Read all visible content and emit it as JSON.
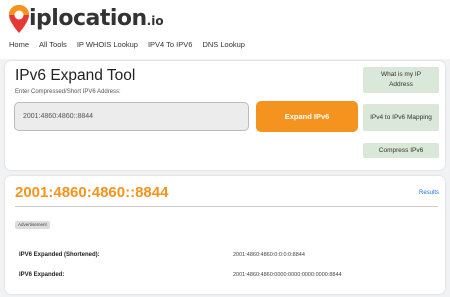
{
  "logo": {
    "brand": "iplocation",
    "tld": ".io"
  },
  "nav": {
    "items": [
      "Home",
      "All Tools",
      "IP WHOIS Lookup",
      "IPV4 To IPV6",
      "DNS Lookup"
    ]
  },
  "tool": {
    "title": "IPv6 Expand Tool",
    "input_label": "Enter Compressed/Short IPV6 Address:",
    "input_value": "2001:4860:4860::8844",
    "expand_button": "Expand IPv6"
  },
  "sidebar": {
    "what_is_my_ip": "What is my IP Address",
    "ipv4_to_ipv6": "IPv4 to IPv6 Mapping",
    "compress_ipv6": "Compress IPv6"
  },
  "result": {
    "title": "2001:4860:4860::8844",
    "results_link": "Results",
    "ad_label": "Advertisement",
    "rows": [
      {
        "label": "IPV6 Expanded (Shortened):",
        "value": "2001:4860:4860:0:0:0:0:8844"
      },
      {
        "label": "IPV6 Expanded:",
        "value": "2001:4860:4860:0000:0000:0000:0000:8844"
      }
    ]
  },
  "colors": {
    "accent": "#f5931f",
    "side_button_bg": "#d9e8d9",
    "link": "#1a73e8",
    "pin_top": "#f5931f",
    "pin_bottom": "#e53935"
  }
}
